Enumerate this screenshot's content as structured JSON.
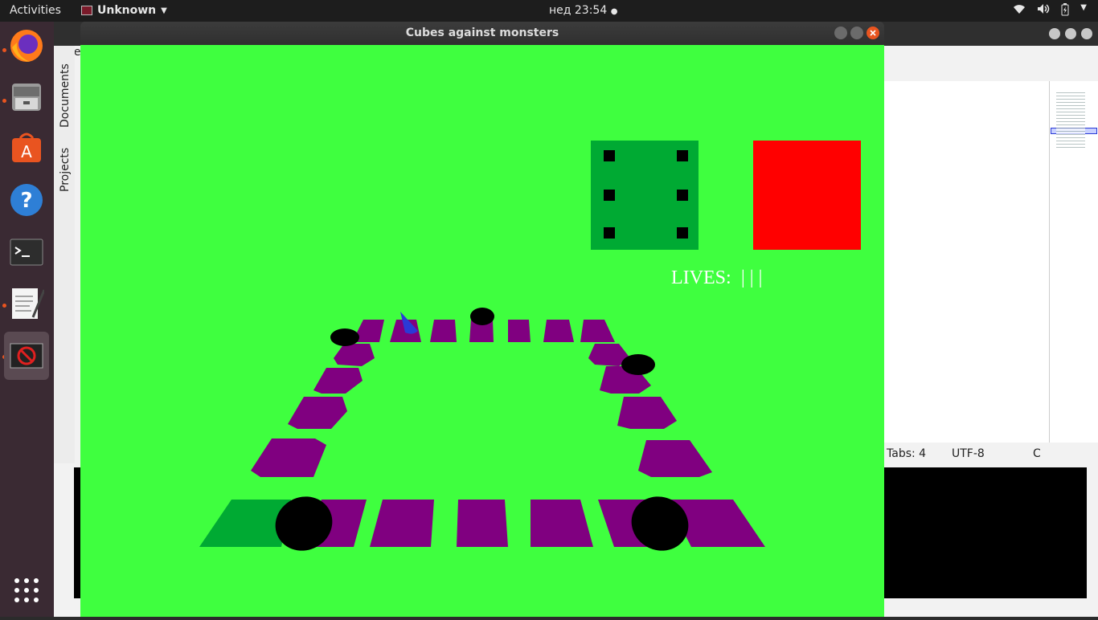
{
  "topbar": {
    "activities": "Activities",
    "app_menu": "Unknown",
    "clock": "нед 23:54"
  },
  "background_window": {
    "menu_file": "File",
    "tab_documents": "Documents",
    "tab_projects": "Projects",
    "status_tabs": "Tabs: 4",
    "status_encoding": "UTF-8",
    "status_language": "C"
  },
  "game_window": {
    "title": "Cubes against monsters",
    "lives_label": "LIVES:",
    "lives_value": "| | |",
    "die_value": 6,
    "colors": {
      "field": "#3fff3f",
      "tile": "#800080",
      "start_tile": "#00aa33",
      "die": "#00aa33",
      "red_block": "#ff0000",
      "player": "#2a3ad6",
      "monster": "#000000"
    }
  },
  "dock": {
    "items": [
      "firefox-icon",
      "files-icon",
      "software-icon",
      "help-icon",
      "terminal-icon",
      "text-editor-icon",
      "app-running-icon",
      "show-apps-icon"
    ]
  }
}
